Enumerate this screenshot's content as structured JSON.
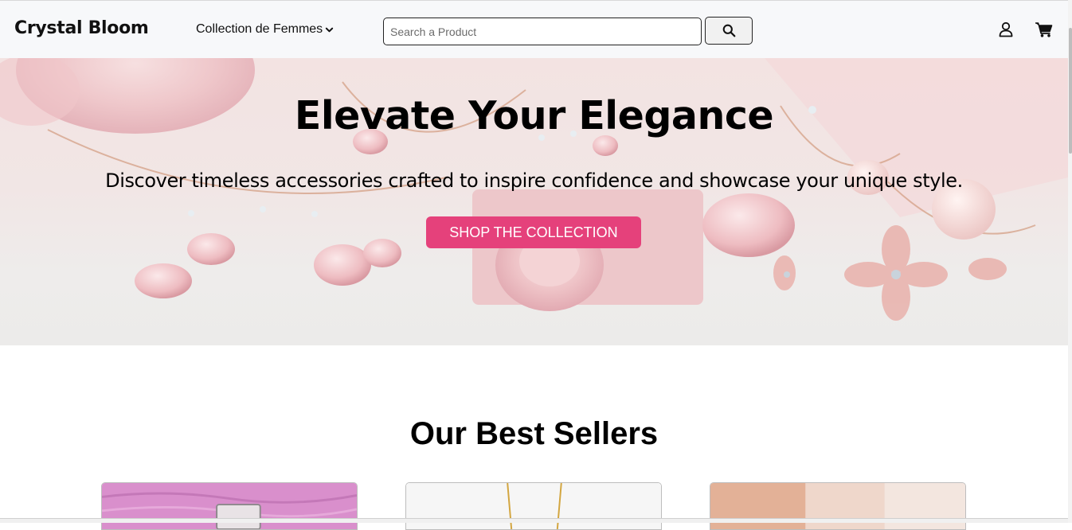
{
  "nav": {
    "brand": "Crystal Bloom",
    "collection_menu": "Collection de Femmes",
    "search_placeholder": "Search a Product",
    "search_value": "",
    "icons": {
      "search": "search-icon",
      "user": "user-icon",
      "cart": "cart-icon",
      "dropdown": "chevron-down-icon"
    }
  },
  "hero": {
    "title": "Elevate Your Elegance",
    "subtitle": "Discover timeless accessories crafted to inspire confidence and showcase your unique style.",
    "cta": "SHOP THE COLLECTION"
  },
  "best_sellers": {
    "title": "Our Best Sellers",
    "products": [
      {
        "image": "pink-product-image"
      },
      {
        "image": "gold-necklace-product-image"
      },
      {
        "image": "bracelet-product-image"
      }
    ]
  },
  "colors": {
    "accent": "#e5417b",
    "navbar_bg": "#f7f8fa",
    "text": "#000000"
  }
}
